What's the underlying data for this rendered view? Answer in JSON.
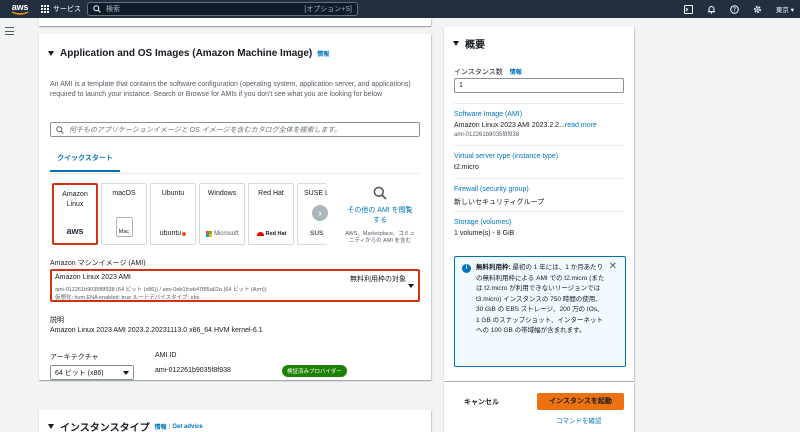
{
  "nav": {
    "logo": "aws",
    "services": "サービス",
    "search_placeholder": "検索",
    "search_shortcut": "[オプション+S]",
    "region": "東京"
  },
  "main": {
    "section_title": "Application and OS Images (Amazon Machine Image)",
    "info": "情報",
    "description": "An AMI is a template that contains the software configuration (operating system, application server, and applications) required to launch your instance. Search or Browse for AMIs if you don't see what you are looking for below",
    "search_placeholder": "何千ものアプリケーションイメージと OS イメージを含むカタログ全体を検索します。",
    "tab": "クイックスタート",
    "os_options": [
      {
        "name": "Amazon Linux",
        "logo": "aws"
      },
      {
        "name": "macOS",
        "logo": "Mac"
      },
      {
        "name": "Ubuntu",
        "logo": "ubuntu"
      },
      {
        "name": "Windows",
        "logo": "Microsoft"
      },
      {
        "name": "Red Hat",
        "logo": "Red Hat"
      },
      {
        "name": "SUSE Li",
        "logo": "SUS"
      }
    ],
    "more_amis": {
      "link": "その他の AMI を閲覧する",
      "sub": "AWS、Marketplace、コミュニティからの AMI を含む"
    },
    "ami_label": "Amazon マシンイメージ (AMI)",
    "ami_selected": {
      "name": "Amazon Linux 2023 AMI",
      "free": "無料利用枠の対象",
      "ids": "ami-012261b9035f8f938 (64 ビット (x86)) / ami-0eb1fceb47f85a62a (64 ビット (Arm))",
      "meta": "仮想化: hvm    ENA enabled: true    ルートデバイスタイプ: ebs"
    },
    "desc_label": "説明",
    "desc_value": "Amazon Linux 2023 AMI 2023.2.20231113.0 x86_64 HVM kernel-6.1",
    "arch_label": "アーキテクチャ",
    "arch_value": "64 ビット (x86)",
    "amiid_label": "AMI ID",
    "amiid_value": "ami-012261b9035f8f938",
    "verified": "検証済みプロバイダー",
    "next_section": "インスタンスタイプ",
    "next_info": "情報",
    "next_advice": "Get advice"
  },
  "summary": {
    "title": "概要",
    "count_label": "インスタンス数",
    "count_info": "情報",
    "count_value": "1",
    "image_label": "Software Image (AMI)",
    "image_value": "Amazon Linux 2023 AMI 2023.2.2...",
    "read_more": "read more",
    "image_id": "ami-012261b9035f8f938",
    "type_label": "Virtual server type (instance type)",
    "type_value": "t2.micro",
    "fw_label": "Firewall (security group)",
    "fw_value": "新しいセキュリティグループ",
    "storage_label": "Storage (volumes)",
    "storage_value": "1 volume(s) - 8 GiB",
    "tip_bold": "無料利用枠:",
    "tip_text": " 最初の 1 年には、1 か月あたりの無料利用枠による AMI での t2.micro (または t2.micro が利用できないリージョンでは t3.micro) インスタンスの 750 時間の使用、30 GiB の EBS ストレージ、200 万の IOs、1 GB のスナップショット、インターネットへの 100 GB の帯域幅が含まれます。"
  },
  "actions": {
    "cancel": "キャンセル",
    "launch": "インスタンスを起動",
    "command": "コマンドを確認"
  }
}
